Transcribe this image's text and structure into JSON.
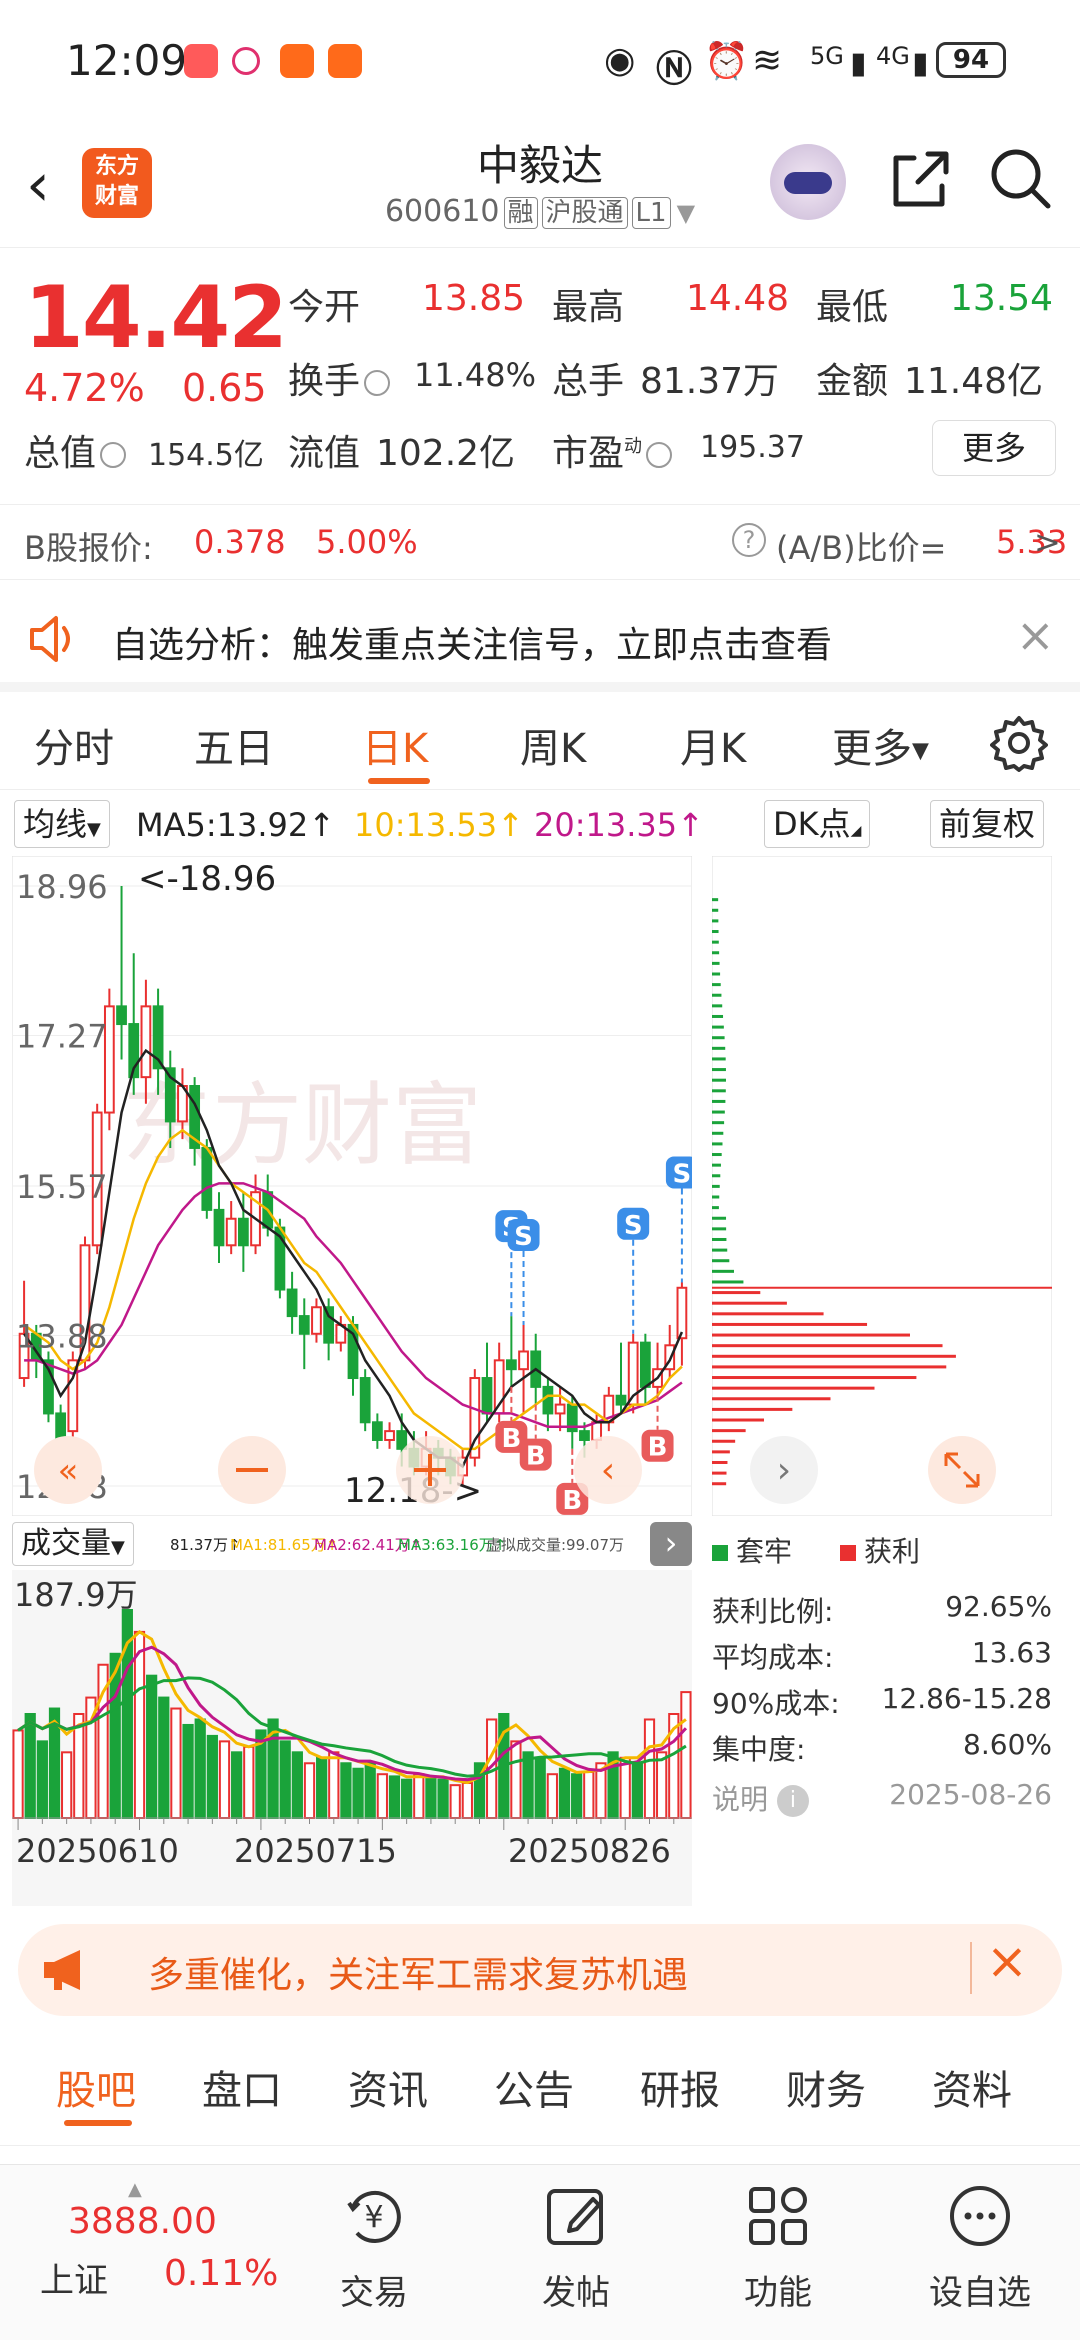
{
  "status_bar": {
    "time": "12:09",
    "network_1": "5G",
    "network_2": "4G",
    "battery": "94"
  },
  "header": {
    "logo_line1": "东方",
    "logo_line2": "财富",
    "stock_name": "中毅达",
    "stock_code": "600610",
    "tags": [
      "融",
      "沪股通",
      "L1"
    ]
  },
  "quote": {
    "price": "14.42",
    "change_pct": "4.72%",
    "change_amt": "0.65",
    "open_label": "今开",
    "open": "13.85",
    "high_label": "最高",
    "high": "14.48",
    "low_label": "最低",
    "low": "13.54",
    "turnover_label": "换手",
    "turnover": "11.48%",
    "volume_label": "总手",
    "volume": "81.37万",
    "amount_label": "金额",
    "amount": "11.48亿",
    "mktcap_label": "总值",
    "mktcap": "154.5亿",
    "float_label": "流值",
    "float": "102.2亿",
    "pe_label": "市盈",
    "pe_sup": "动",
    "pe": "195.37",
    "more_label": "更多"
  },
  "bshare": {
    "label": "B股报价:",
    "price": "0.378",
    "pct": "5.00%",
    "ratio_label": "(A/B)比价=",
    "ratio": "5.33",
    "arrow": ">"
  },
  "banner1": {
    "text": "自选分析：触发重点关注信号，立即点击查看"
  },
  "ktabs": [
    "分时",
    "五日",
    "日K",
    "周K",
    "月K",
    "更多"
  ],
  "ktab_active": 2,
  "ma_row": {
    "selector": "均线",
    "ma5": "MA5:13.92↑",
    "ma10": "10:13.53↑",
    "ma20": "20:13.35↑",
    "dk_button": "DK点",
    "fq_button": "前复权"
  },
  "colors": {
    "up": "#e93030",
    "down": "#1aa33a",
    "ma5": "#222222",
    "ma10": "#f5b800",
    "ma20": "#c0188a",
    "accent": "#f0621e"
  },
  "chart_data": {
    "type": "candlestick",
    "y_ticks": [
      "18.96",
      "17.27",
      "15.57",
      "13.88",
      "12.18"
    ],
    "ylim": [
      12.18,
      18.96
    ],
    "max_label": "<-18.96",
    "min_label": "12.18->",
    "markers": [
      {
        "label": "S",
        "index": 40
      },
      {
        "label": "B",
        "index": 40
      },
      {
        "label": "S",
        "index": 41
      },
      {
        "label": "B",
        "index": 42
      },
      {
        "label": "B",
        "index": 45
      },
      {
        "label": "S",
        "index": 50
      },
      {
        "label": "B",
        "index": 52
      },
      {
        "label": "S",
        "index": 54
      }
    ],
    "candles": [
      [
        13.4,
        13.9,
        14.5,
        13.3
      ],
      [
        13.9,
        13.6,
        14.0,
        13.4
      ],
      [
        13.6,
        13.0,
        13.7,
        12.9
      ],
      [
        13.0,
        12.7,
        13.1,
        12.5
      ],
      [
        12.8,
        13.6,
        13.7,
        12.7
      ],
      [
        13.6,
        14.9,
        15.0,
        13.5
      ],
      [
        14.9,
        16.4,
        16.5,
        14.8
      ],
      [
        16.4,
        17.6,
        17.8,
        16.2
      ],
      [
        17.6,
        17.4,
        18.96,
        17.0
      ],
      [
        17.4,
        16.8,
        18.2,
        16.6
      ],
      [
        16.8,
        17.6,
        17.9,
        16.5
      ],
      [
        17.6,
        16.9,
        17.8,
        16.6
      ],
      [
        16.9,
        16.3,
        17.1,
        16.0
      ],
      [
        16.3,
        16.7,
        16.9,
        16.1
      ],
      [
        16.7,
        16.0,
        16.8,
        15.8
      ],
      [
        16.0,
        15.3,
        16.1,
        15.2
      ],
      [
        15.3,
        14.9,
        15.5,
        14.7
      ],
      [
        14.9,
        15.2,
        15.4,
        14.8
      ],
      [
        15.2,
        14.9,
        15.5,
        14.6
      ],
      [
        14.9,
        15.5,
        15.7,
        14.8
      ],
      [
        15.5,
        15.1,
        15.7,
        15.0
      ],
      [
        15.1,
        14.4,
        15.2,
        14.3
      ],
      [
        14.4,
        14.1,
        14.6,
        13.9
      ],
      [
        14.1,
        13.9,
        14.3,
        13.5
      ],
      [
        13.9,
        14.2,
        14.3,
        13.8
      ],
      [
        14.2,
        13.8,
        14.3,
        13.6
      ],
      [
        13.8,
        14.0,
        14.1,
        13.7
      ],
      [
        14.0,
        13.4,
        14.1,
        13.2
      ],
      [
        13.4,
        12.9,
        13.5,
        12.8
      ],
      [
        12.9,
        12.7,
        13.0,
        12.6
      ],
      [
        12.7,
        12.8,
        12.9,
        12.6
      ],
      [
        12.8,
        12.6,
        13.0,
        12.4
      ],
      [
        12.6,
        12.4,
        12.8,
        12.3
      ],
      [
        12.4,
        12.6,
        12.8,
        12.3
      ],
      [
        12.6,
        12.5,
        12.7,
        12.3
      ],
      [
        12.5,
        12.3,
        12.6,
        12.2
      ],
      [
        12.3,
        12.5,
        12.6,
        12.18
      ],
      [
        12.5,
        13.4,
        13.5,
        12.4
      ],
      [
        13.4,
        13.0,
        13.8,
        12.9
      ],
      [
        13.0,
        13.6,
        13.8,
        12.9
      ],
      [
        13.6,
        13.5,
        14.1,
        13.3
      ],
      [
        13.5,
        13.7,
        14.0,
        13.0
      ],
      [
        13.7,
        13.3,
        13.9,
        13.1
      ],
      [
        13.3,
        13.0,
        13.4,
        12.8
      ],
      [
        13.0,
        13.1,
        13.3,
        12.8
      ],
      [
        13.1,
        12.8,
        13.2,
        12.6
      ],
      [
        12.8,
        12.7,
        12.9,
        12.5
      ],
      [
        12.7,
        12.9,
        13.0,
        12.6
      ],
      [
        12.9,
        13.2,
        13.3,
        12.8
      ],
      [
        13.2,
        13.1,
        13.8,
        13.0
      ],
      [
        13.1,
        13.8,
        13.9,
        13.0
      ],
      [
        13.8,
        13.3,
        13.9,
        13.1
      ],
      [
        13.3,
        13.5,
        13.8,
        13.2
      ],
      [
        13.5,
        13.77,
        14.0,
        13.4
      ],
      [
        13.85,
        14.42,
        14.48,
        13.54
      ]
    ],
    "ma5": [
      13.9,
      13.7,
      13.5,
      13.2,
      13.4,
      13.8,
      14.6,
      15.5,
      16.4,
      16.9,
      17.1,
      17.0,
      16.8,
      16.7,
      16.5,
      16.2,
      15.8,
      15.6,
      15.3,
      15.2,
      15.1,
      15.0,
      14.8,
      14.6,
      14.4,
      14.1,
      14.0,
      13.9,
      13.6,
      13.4,
      13.2,
      12.9,
      12.7,
      12.6,
      12.5,
      12.5,
      12.4,
      12.7,
      12.9,
      13.1,
      13.3,
      13.4,
      13.5,
      13.4,
      13.3,
      13.2,
      13.0,
      12.9,
      12.9,
      13.0,
      13.2,
      13.3,
      13.4,
      13.6,
      13.92
    ],
    "ma10": [
      14.0,
      13.9,
      13.8,
      13.6,
      13.5,
      13.6,
      13.8,
      14.2,
      14.7,
      15.2,
      15.6,
      15.9,
      16.1,
      16.2,
      16.1,
      16.0,
      15.8,
      15.6,
      15.5,
      15.4,
      15.3,
      15.1,
      14.9,
      14.7,
      14.6,
      14.4,
      14.2,
      14.0,
      13.8,
      13.6,
      13.4,
      13.2,
      13.0,
      12.9,
      12.8,
      12.7,
      12.6,
      12.6,
      12.7,
      12.8,
      12.9,
      13.0,
      13.1,
      13.2,
      13.2,
      13.1,
      13.1,
      13.0,
      12.9,
      13.0,
      13.1,
      13.1,
      13.2,
      13.4,
      13.53
    ],
    "ma20": [
      13.6,
      13.6,
      13.55,
      13.5,
      13.45,
      13.5,
      13.6,
      13.8,
      14.0,
      14.3,
      14.6,
      14.9,
      15.1,
      15.3,
      15.45,
      15.55,
      15.6,
      15.6,
      15.6,
      15.55,
      15.5,
      15.4,
      15.3,
      15.2,
      15.0,
      14.85,
      14.7,
      14.5,
      14.3,
      14.1,
      13.9,
      13.7,
      13.55,
      13.4,
      13.3,
      13.2,
      13.1,
      13.05,
      13.0,
      13.0,
      13.0,
      12.95,
      12.9,
      12.85,
      12.85,
      12.85,
      12.85,
      12.9,
      12.95,
      13.0,
      13.05,
      13.1,
      13.15,
      13.25,
      13.35
    ]
  },
  "chip": {
    "legend_trapped": "套牢",
    "legend_profit": "获利",
    "rows": [
      {
        "label": "获利比例:",
        "value": "92.65%"
      },
      {
        "label": "平均成本:",
        "value": "13.63"
      },
      {
        "label": "90%成本:",
        "value": "12.86-15.28"
      },
      {
        "label": "集中度:",
        "value": "8.60%"
      }
    ],
    "note_label": "说明",
    "date": "2025-08-26"
  },
  "volume": {
    "selector": "成交量",
    "vol": "81.37万↑",
    "ma1": "MA1:81.65万↑",
    "ma2": "MA2:62.41万↑",
    "ma3": "MA3:63.16万↑",
    "virtual": "虚拟成交量:99.07万",
    "max_label": "187.9万",
    "dates": [
      "20250610",
      "20250715",
      "20250826"
    ],
    "values": [
      80,
      95,
      70,
      100,
      60,
      95,
      110,
      140,
      150,
      190,
      170,
      130,
      110,
      100,
      85,
      90,
      75,
      70,
      60,
      65,
      80,
      90,
      70,
      60,
      50,
      55,
      60,
      50,
      45,
      50,
      40,
      38,
      35,
      40,
      38,
      35,
      30,
      32,
      50,
      90,
      95,
      70,
      60,
      55,
      40,
      45,
      40,
      42,
      50,
      60,
      55,
      50,
      90,
      60,
      95,
      115
    ]
  },
  "banner2": {
    "text": "多重催化，关注军工需求复苏机遇"
  },
  "btabs": [
    "股吧",
    "盘口",
    "资讯",
    "公告",
    "研报",
    "财务",
    "资料"
  ],
  "bottom": {
    "index_value": "3888.00",
    "index_name": "上证",
    "index_pct": "0.11%",
    "nav": [
      "交易",
      "发帖",
      "功能",
      "设自选"
    ]
  }
}
